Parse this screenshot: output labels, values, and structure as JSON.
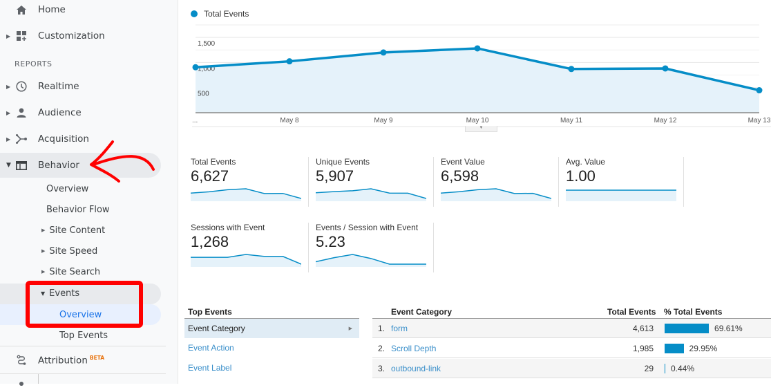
{
  "sidebar": {
    "home": "Home",
    "customization": "Customization",
    "reports_heading": "REPORTS",
    "realtime": "Realtime",
    "audience": "Audience",
    "acquisition": "Acquisition",
    "behavior": "Behavior",
    "behavior_sub": {
      "overview": "Overview",
      "behavior_flow": "Behavior Flow",
      "site_content": "Site Content",
      "site_speed": "Site Speed",
      "site_search": "Site Search",
      "events": "Events",
      "events_overview": "Overview",
      "top_events": "Top Events"
    },
    "attribution": "Attribution",
    "attribution_badge": "BETA"
  },
  "chart_data": {
    "type": "area",
    "title": "",
    "legend": [
      "Total Events"
    ],
    "legend_position": "top-left",
    "x": [
      "...",
      "May 8",
      "May 9",
      "May 10",
      "May 11",
      "May 12",
      "May 13"
    ],
    "series": [
      {
        "name": "Total Events",
        "values": [
          906,
          1024,
          1200,
          1282,
          871,
          882,
          447
        ]
      }
    ],
    "yticks": [
      "1,500",
      "1,000",
      "500"
    ],
    "ytick_values": [
      1500,
      1000,
      500
    ],
    "ylim": [
      0,
      1750
    ],
    "grid": true,
    "colors": {
      "line": "#058dc7",
      "fill": "#e5f2fa"
    }
  },
  "scorecards": [
    {
      "title": "Total Events",
      "value": "6,627",
      "spark": [
        906,
        1024,
        1200,
        1282,
        871,
        882,
        447
      ]
    },
    {
      "title": "Unique Events",
      "value": "5,907",
      "spark": [
        840,
        900,
        950,
        1060,
        820,
        815,
        520
      ]
    },
    {
      "title": "Event Value",
      "value": "6,598",
      "spark": [
        900,
        1020,
        1195,
        1275,
        868,
        880,
        440
      ]
    },
    {
      "title": "Avg. Value",
      "value": "1.00",
      "spark": [
        1,
        1,
        1,
        1,
        1,
        1,
        1
      ]
    },
    {
      "title": "Sessions with Event",
      "value": "1,268",
      "spark": [
        190,
        190,
        190,
        215,
        198,
        198,
        130
      ]
    },
    {
      "title": "Events / Session with Event",
      "value": "5.23",
      "spark": [
        5.1,
        5.35,
        5.55,
        5.3,
        4.95,
        4.95,
        4.95
      ]
    }
  ],
  "top_events": {
    "heading": "Top Events",
    "items": [
      "Event Category",
      "Event Action",
      "Event Label"
    ],
    "active_index": 0
  },
  "table": {
    "headers": {
      "category": "Event Category",
      "total": "Total Events",
      "pct": "% Total Events"
    },
    "rows": [
      {
        "num": "1.",
        "name": "form",
        "total": "4,613",
        "pct": "69.61%",
        "pct_value": 69.61
      },
      {
        "num": "2.",
        "name": "Scroll Depth",
        "total": "1,985",
        "pct": "29.95%",
        "pct_value": 29.95
      },
      {
        "num": "3.",
        "name": "outbound-link",
        "total": "29",
        "pct": "0.44%",
        "pct_value": 0.44
      }
    ]
  }
}
